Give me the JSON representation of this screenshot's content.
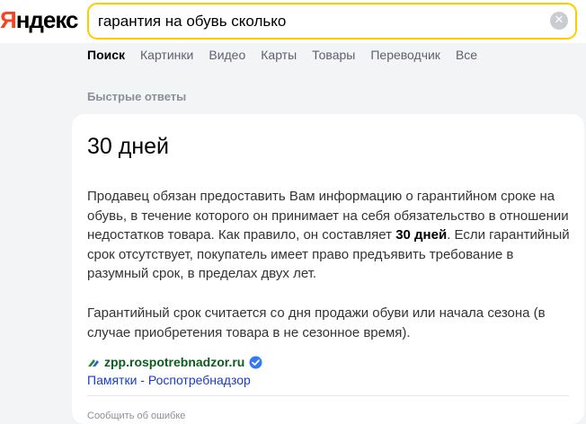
{
  "header": {
    "logo_first": "Я",
    "logo_rest": "ндекс",
    "search_value": "гарантия на обувь сколько",
    "clear_label": "✕"
  },
  "tabs": [
    {
      "label": "Поиск",
      "active": true
    },
    {
      "label": "Картинки"
    },
    {
      "label": "Видео"
    },
    {
      "label": "Карты"
    },
    {
      "label": "Товары"
    },
    {
      "label": "Переводчик"
    },
    {
      "label": "Все"
    }
  ],
  "quick_answers": {
    "section_title": "Быстрые ответы",
    "answer": "30 дней",
    "para1_a": "Продавец обязан предоставить Вам информацию о гарантийном сроке на обувь, в течение которого он принимает на себя обязательство в отношении недостатков товара. Как правило, он составляет ",
    "para1_bold": "30 дней",
    "para1_b": ". Если гарантийный срок отсутствует, покупатель имеет право предъявить требование в разумный срок, в пределах двух лет.",
    "para2": "Гарантийный срок считается со дня продажи обуви или начала сезона (в случае приобретения товара в не сезонное время).",
    "source_host": "zpp.rospotrebnadzor.ru",
    "source_title": "Памятки - Роспотребнадзор",
    "report_label": "Сообщить об ошибке"
  },
  "colors": {
    "accent_search_border": "#ffcc00",
    "logo_red": "#fc3f1d",
    "link_blue": "#1a3dc1",
    "host_green": "#0b5d1e",
    "verified_blue": "#3478f6"
  },
  "icons": {
    "clear": "clear-icon",
    "favicon": "rospotrebnadzor-favicon-icon",
    "verified": "verified-check-icon"
  }
}
